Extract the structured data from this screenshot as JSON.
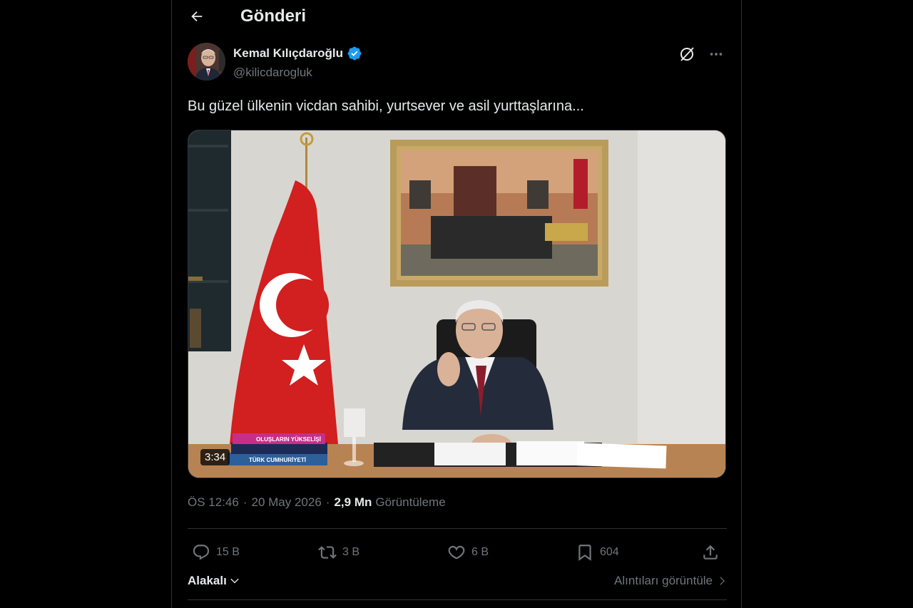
{
  "header": {
    "title": "Gönderi"
  },
  "author": {
    "display_name": "Kemal Kılıçdaroğlu",
    "handle": "@kilicdarogluk",
    "verified": true
  },
  "post": {
    "text": "Bu güzel ülkenin vicdan sahibi, yurtsever ve asil yurttaşlarına...",
    "media": {
      "type": "video",
      "duration": "3:34",
      "book_titles": [
        "OLUŞLARIN YÜKSELİŞİ",
        "TÜRK CUMHURİYETİ"
      ]
    },
    "time": "ÖS 12:46",
    "date": "20 May 2026",
    "separator": "·",
    "views_count": "2,9 Mn",
    "views_label": "Görüntüleme"
  },
  "actions": {
    "replies": "15 B",
    "reposts": "3 B",
    "likes": "6 B",
    "bookmarks": "604"
  },
  "footer": {
    "sort_label": "Alakalı",
    "quotes_label": "Alıntıları görüntüle"
  },
  "colors": {
    "background": "#000000",
    "text": "#e7e9ea",
    "secondary": "#71767b",
    "verified": "#1d9bf0",
    "border": "#2f3336"
  },
  "icons": [
    "back-arrow-icon",
    "verified-badge-icon",
    "grok-icon",
    "more-icon",
    "reply-icon",
    "repost-icon",
    "like-icon",
    "bookmark-icon",
    "share-icon",
    "chevron-down-icon",
    "chevron-right-icon"
  ]
}
